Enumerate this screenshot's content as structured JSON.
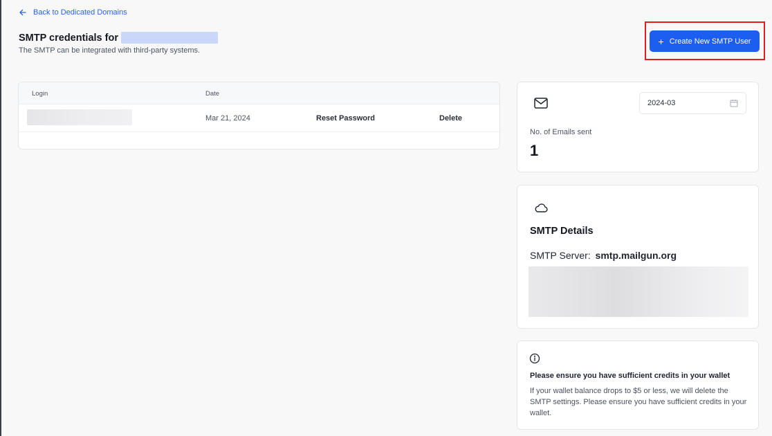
{
  "header": {
    "back_label": "Back to Dedicated Domains",
    "title": "SMTP credentials for",
    "subtitle": "The SMTP can be integrated with third-party systems.",
    "create_button_label": "Create New SMTP User"
  },
  "table": {
    "columns": [
      "Login",
      "Date"
    ],
    "rows": [
      {
        "login": "",
        "date": "Mar 21, 2024",
        "reset_label": "Reset Password",
        "delete_label": "Delete"
      }
    ]
  },
  "emails_card": {
    "month_value": "2024-03",
    "label": "No. of Emails sent",
    "count": "1"
  },
  "smtp_card": {
    "title": "SMTP Details",
    "server_label": "SMTP Server:",
    "server_value": "smtp.mailgun.org"
  },
  "info_card": {
    "title": "Please ensure you have sufficient credits in your wallet",
    "body": "If your wallet balance drops to $5 or less, we will delete the SMTP settings. Please ensure you have sufficient credits in your wallet."
  },
  "colors": {
    "accent": "#1b5ef0",
    "highlight": "#e21d1d",
    "link": "#2563eb"
  }
}
